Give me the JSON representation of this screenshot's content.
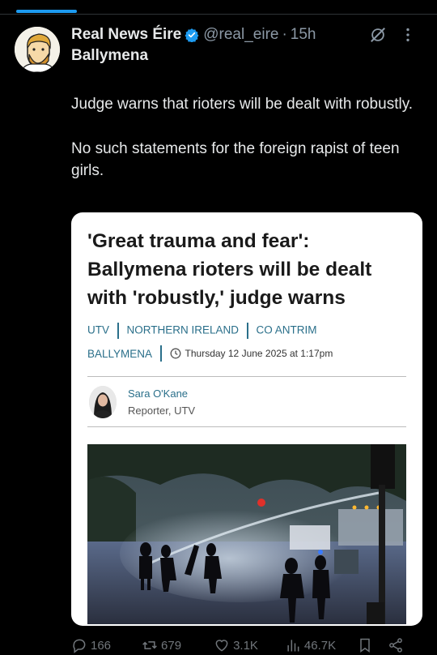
{
  "post": {
    "display_name": "Real News Éire",
    "handle": "@real_eire",
    "separator": "·",
    "time": "15h",
    "location": "Ballymena",
    "text_paragraphs": [
      "Judge warns that rioters will be dealt with robustly.",
      "No such statements for the foreign rapist of teen girls."
    ]
  },
  "article": {
    "title": "'Great trauma and fear': Ballymena rioters will be dealt with 'robustly,' judge warns",
    "tags_row1": [
      "UTV",
      "NORTHERN IRELAND",
      "CO ANTRIM"
    ],
    "tag_row2": "BALLYMENA",
    "date": "Thursday 12 June 2025 at 1:17pm",
    "reporter_name": "Sara O'Kane",
    "reporter_role": "Reporter, UTV"
  },
  "actions": {
    "replies": "166",
    "reposts": "679",
    "likes": "3.1K",
    "views": "46.7K"
  },
  "icons": [
    "verified-badge-icon",
    "grok-icon",
    "more-icon",
    "reply-icon",
    "repost-icon",
    "like-icon",
    "views-icon",
    "bookmark-icon",
    "share-icon",
    "clock-icon"
  ],
  "colors": {
    "background": "#000000",
    "accent": "#1d9bf0",
    "secondary_text": "#8b98a5",
    "article_link": "#2a6f8a"
  }
}
